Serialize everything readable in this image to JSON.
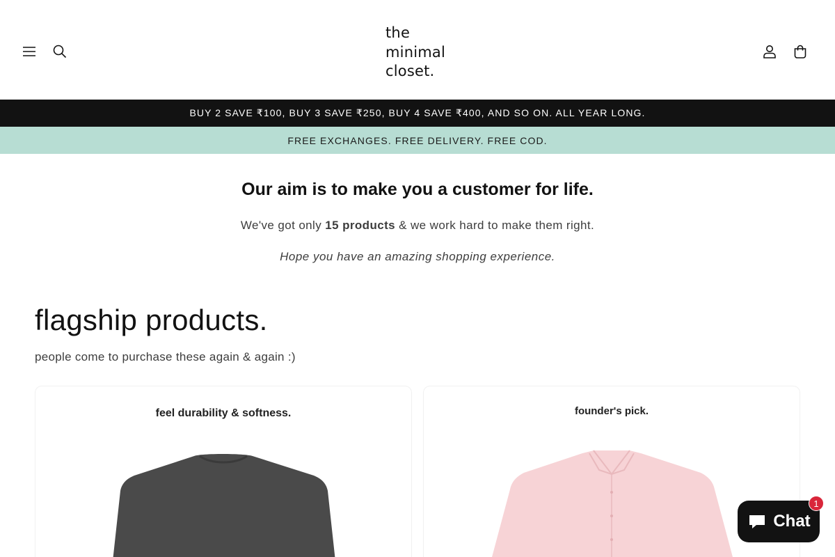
{
  "header": {
    "logo_line1": "the",
    "logo_line2": "minimal",
    "logo_line3": "closet.",
    "icons": [
      "menu-icon",
      "search-icon",
      "account-icon",
      "cart-icon"
    ]
  },
  "announcements": {
    "offer": "BUY 2 SAVE ₹100, BUY 3 SAVE ₹250, BUY 4 SAVE ₹400, AND SO ON. ALL YEAR LONG.",
    "perks": "FREE EXCHANGES. FREE DELIVERY. FREE COD."
  },
  "intro": {
    "title": "Our aim is to make you a customer for life.",
    "line_pre": "We've got only ",
    "line_bold": "15 products",
    "line_post": " & we work hard to make them right.",
    "italic": "Hope you have an amazing shopping experience."
  },
  "flagship": {
    "title": "flagship products.",
    "subtitle": "people come to purchase these again & again :)",
    "cards": [
      {
        "caption": "feel durability & softness.",
        "garment_color": "#4a4a4a"
      },
      {
        "caption": "founder's pick.",
        "garment_color": "#f7d3d6"
      }
    ]
  },
  "chat": {
    "label": "Chat",
    "badge": "1"
  },
  "colors": {
    "announcement_dark": "#121212",
    "announcement_mint": "#b7ddd3",
    "badge": "#d9263a"
  }
}
